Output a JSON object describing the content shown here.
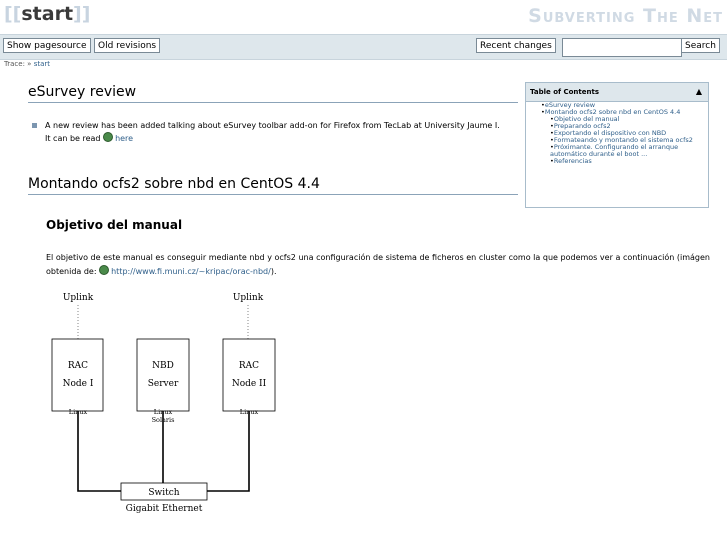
{
  "header": {
    "title_open": "[[",
    "title": "start",
    "title_close": "]]",
    "tagline": "Subverting The Net"
  },
  "toolbar": {
    "show_source": "Show pagesource",
    "old_revisions": "Old revisions",
    "recent_changes": "Recent changes",
    "search_value": "",
    "search_button": "Search"
  },
  "trace": {
    "label": "Trace:",
    "sep": "»",
    "crumb": "start"
  },
  "content": {
    "h1": "eSurvey review",
    "review_text": "A new review has been added talking about eSurvey toolbar add-on for Firefox from TecLab at University Jaume I.",
    "read_text": "It can be read",
    "read_link": "here",
    "h1b": "Montando ocfs2 sobre nbd en CentOS 4.4",
    "h2": "Objetivo del manual",
    "para_text": "El objetivo de este manual es conseguir mediante nbd y ocfs2 una configuración de sistema de ficheros en cluster como la que podemos ver a continuación (imágen obtenida de:",
    "para_link": "http://www.fi.muni.cz/~kripac/orac-nbd/",
    "para_end": ")."
  },
  "toc": {
    "title": "Table of Contents",
    "toggle": "▲",
    "items": [
      {
        "label": "eSurvey review",
        "level": 1
      },
      {
        "label": "Montando ocfs2 sobre nbd en CentOS 4.4",
        "level": 1
      },
      {
        "label": "Objetivo del manual",
        "level": 2
      },
      {
        "label": "Preparando ocfs2",
        "level": 2
      },
      {
        "label": "Exportando el dispositivo con NBD",
        "level": 2
      },
      {
        "label": "Formateando y montando el sistema ocfs2",
        "level": 2
      },
      {
        "label": "Próximante. Configurando el arranque automático durante el boot ...",
        "level": 2
      },
      {
        "label": "Referencias",
        "level": 2
      }
    ]
  },
  "diagram": {
    "uplink1": "Uplink",
    "uplink2": "Uplink",
    "box1_line1": "RAC",
    "box1_line2": "Node I",
    "box1_os": "Linux",
    "box2_line1": "NBD",
    "box2_line2": "Server",
    "box2_os1": "Linux",
    "box2_os2": "Solaris",
    "box3_line1": "RAC",
    "box3_line2": "Node II",
    "box3_os": "Linux",
    "switch": "Switch",
    "network": "Gigabit Ethernet"
  }
}
